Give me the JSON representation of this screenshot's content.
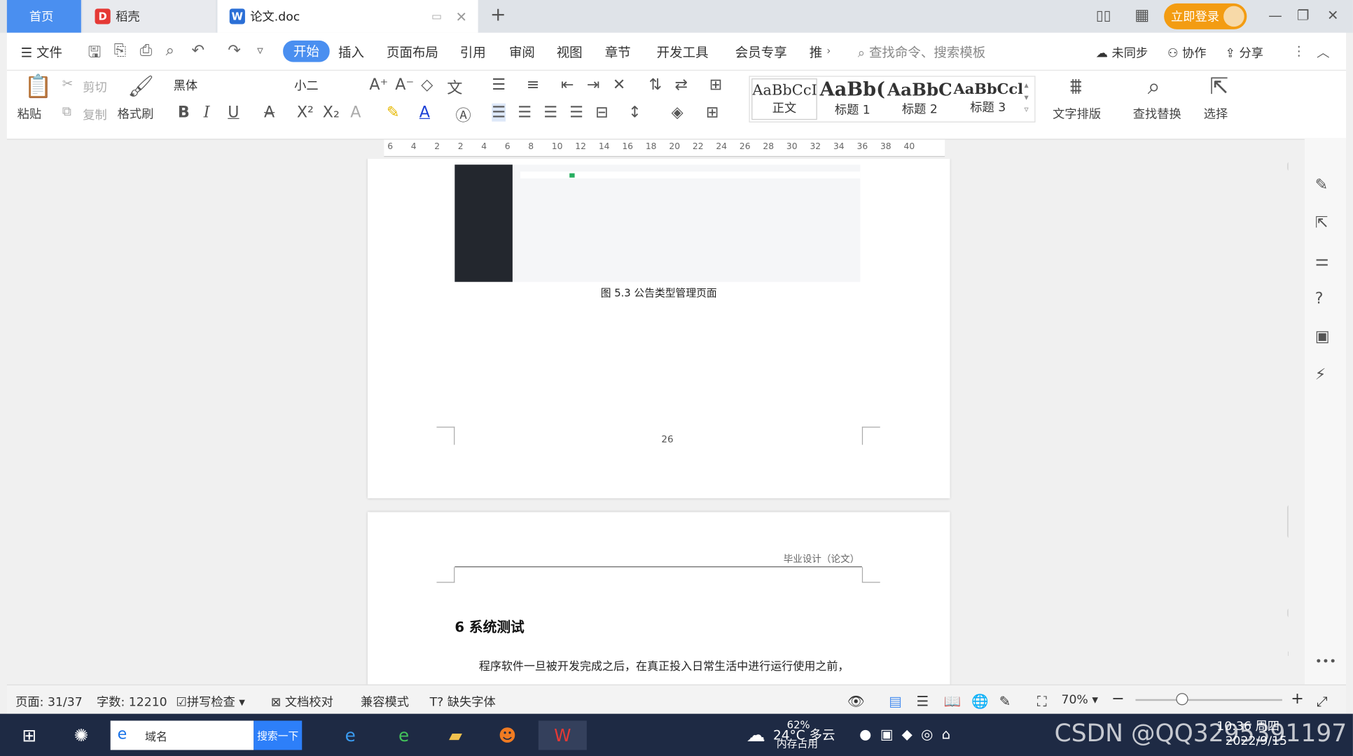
{
  "tabs": {
    "home": "首页",
    "daoke": "稻壳",
    "doc": "论文.doc",
    "new_tab": "+"
  },
  "login_button": "立即登录",
  "menu": {
    "file": "文件",
    "items": [
      "开始",
      "插入",
      "页面布局",
      "引用",
      "审阅",
      "视图",
      "章节",
      "开发工具",
      "会员专享",
      "推"
    ],
    "search_placeholder": "查找命令、搜索模板",
    "sync": "未同步",
    "collab": "协作",
    "share": "分享"
  },
  "ribbon": {
    "paste": "粘贴",
    "cut": "剪切",
    "copy": "复制",
    "format_painter": "格式刷",
    "font_name": "黑体",
    "font_size": "小二",
    "styles": [
      {
        "preview": "AaBbCcI",
        "label": "正文"
      },
      {
        "preview": "AaBb(",
        "label": "标题 1"
      },
      {
        "preview": "AaBbC",
        "label": "标题 2"
      },
      {
        "preview": "AaBbCcl",
        "label": "标题 3"
      }
    ],
    "text_layout": "文字排版",
    "find_replace": "查找替换",
    "select": "选择"
  },
  "ruler_ticks": [
    "6",
    "4",
    "2",
    "2",
    "4",
    "6",
    "8",
    "10",
    "12",
    "14",
    "16",
    "18",
    "20",
    "22",
    "24",
    "26",
    "28",
    "30",
    "32",
    "34",
    "36",
    "38",
    "40"
  ],
  "document": {
    "figure_caption": "图 5.3 公告类型管理页面",
    "page_number": "26",
    "header_text": "毕业设计（论文）",
    "section_heading": "6  系统测试",
    "body_text": "程序软件一旦被开发完成之后，在真正投入日常生活中进行运行使用之前，"
  },
  "status": {
    "page": "页面: 31/37",
    "word_count": "字数: 12210",
    "spell_check": "拼写检查",
    "doc_proof": "文档校对",
    "compat_mode": "兼容模式",
    "missing_font": "缺失字体",
    "zoom": "70%"
  },
  "taskbar": {
    "search_text": "域名",
    "search_button": "搜索一下",
    "weather": "24°C 多云",
    "memory": "62%",
    "memory_label": "内存占用",
    "time": "10:36 周四",
    "date": "2022/9/15",
    "watermark": "CSDN @QQ3295391197"
  },
  "colors": {
    "accent": "#4a8ff0",
    "login": "#f39c12",
    "taskbar": "#1e2a44"
  }
}
